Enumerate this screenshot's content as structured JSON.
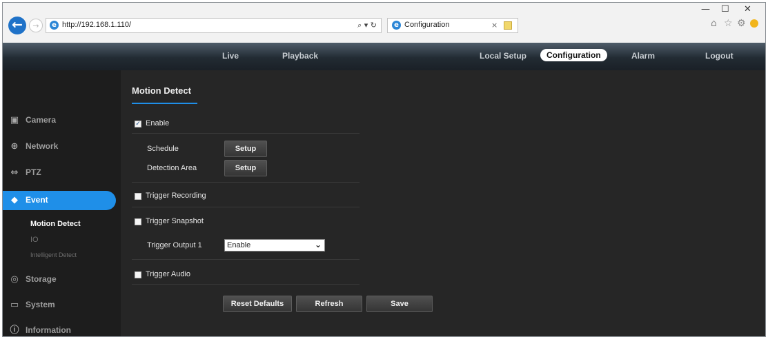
{
  "browser": {
    "url": "http://192.168.1.110/",
    "url_controls": "⌕ ▾ ↻",
    "tab_title": "Configuration",
    "tab_close": "×",
    "back_glyph": "←",
    "forward_glyph": "→",
    "ie_glyph": "e",
    "window_controls": {
      "minimize": "—",
      "maximize": "☐",
      "close": "✕"
    },
    "toolbar_icons": [
      "home-icon",
      "star-icon",
      "gear-icon",
      "smiley-icon"
    ],
    "toolbar_glyphs": {
      "home": "⌂",
      "star": "☆",
      "gear": "⚙"
    }
  },
  "nav": {
    "left": [
      "Live",
      "Playback"
    ],
    "right": [
      "Local Setup",
      "Configuration",
      "Alarm",
      "Logout"
    ],
    "active": "Configuration"
  },
  "sidebar": {
    "items": [
      {
        "label": "Camera",
        "icon": "camera-icon",
        "glyph": "▣"
      },
      {
        "label": "Network",
        "icon": "network-icon",
        "glyph": "⊕"
      },
      {
        "label": "PTZ",
        "icon": "ptz-icon",
        "glyph": "⇔"
      },
      {
        "label": "Event",
        "icon": "event-icon",
        "glyph": "◆"
      },
      {
        "label": "Storage",
        "icon": "storage-icon",
        "glyph": "◎"
      },
      {
        "label": "System",
        "icon": "system-icon",
        "glyph": "▭"
      },
      {
        "label": "Information",
        "icon": "information-icon",
        "glyph": "ⓘ"
      }
    ],
    "active_item": "Event",
    "event_subitems": [
      "Motion Detect",
      "IO",
      "Intelligent Detect"
    ],
    "active_subitem": "Motion Detect"
  },
  "content": {
    "title": "Motion Detect",
    "enable": {
      "label": "Enable",
      "checked": true,
      "mark": "✓"
    },
    "schedule_label": "Schedule",
    "detection_area_label": "Detection Area",
    "setup_label": "Setup",
    "trigger_recording": {
      "label": "Trigger Recording",
      "checked": false
    },
    "trigger_snapshot": {
      "label": "Trigger Snapshot",
      "checked": false
    },
    "trigger_output": {
      "label": "Trigger Output 1",
      "value": "Enable",
      "arrow": "⌄"
    },
    "trigger_audio": {
      "label": "Trigger Audio",
      "checked": false
    },
    "buttons": {
      "reset": "Reset Defaults",
      "refresh": "Refresh",
      "save": "Save"
    }
  },
  "colors": {
    "accent": "#1f8fe8",
    "sidebar_bg": "#1d1d1d",
    "content_bg": "#262626",
    "header_bg": "#222b33"
  }
}
